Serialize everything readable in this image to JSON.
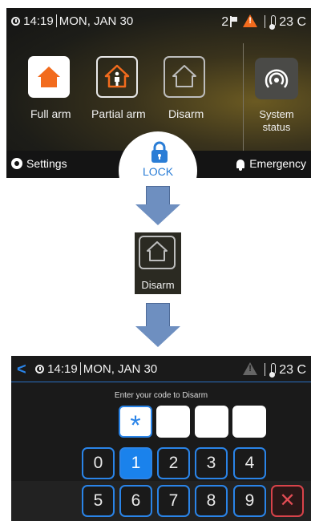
{
  "screen1": {
    "time": "14:19",
    "date": "MON, JAN 30",
    "notification_count": "2",
    "temperature": "23 C",
    "tiles": {
      "full_arm": "Full arm",
      "partial_arm": "Partial arm",
      "disarm": "Disarm",
      "system_status_line1": "System",
      "system_status_line2": "status"
    },
    "settings": "Settings",
    "lock": "LOCK",
    "emergency": "Emergency",
    "colors": {
      "accent_orange": "#f26b1d",
      "accent_blue": "#2a7dd6"
    }
  },
  "middle": {
    "disarm_label": "Disarm"
  },
  "screen2": {
    "time": "14:19",
    "date": "MON, JAN 30",
    "temperature": "23 C",
    "prompt": "Enter your code to Disarm",
    "code_entered_symbol": "*",
    "keys": [
      "0",
      "1",
      "2",
      "3",
      "4",
      "5",
      "6",
      "7",
      "8",
      "9"
    ],
    "selected_key": "1",
    "delete_symbol": "✕"
  }
}
